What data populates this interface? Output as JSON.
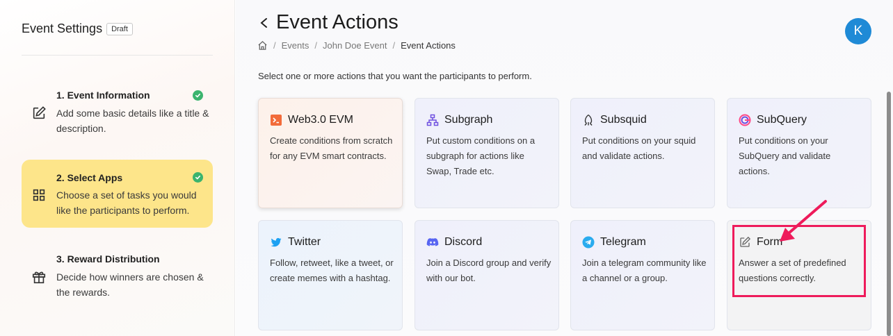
{
  "sidebar": {
    "title": "Event Settings",
    "badge": "Draft",
    "steps": [
      {
        "title": "1. Event Information",
        "desc": "Add some basic details like a title & description.",
        "icon": "edit-icon",
        "completed": true,
        "active": false
      },
      {
        "title": "2. Select Apps",
        "desc": "Choose a set of tasks you would like the participants to perform.",
        "icon": "grid-icon",
        "completed": true,
        "active": true
      },
      {
        "title": "3. Reward Distribution",
        "desc": "Decide how winners are chosen & the rewards.",
        "icon": "gift-icon",
        "completed": false,
        "active": false
      }
    ]
  },
  "header": {
    "title": "Event Actions",
    "breadcrumb": [
      "Events",
      "John Doe Event",
      "Event Actions"
    ],
    "avatar_letter": "K"
  },
  "instruction": "Select one or more actions that you want the participants to perform.",
  "cards": [
    {
      "title": "Web3.0 EVM",
      "desc": "Create conditions from scratch for any EVM smart contracts.",
      "icon": "terminal-icon",
      "color": "#f26b3a"
    },
    {
      "title": "Subgraph",
      "desc": "Put custom conditions on a subgraph for actions like Swap, Trade etc.",
      "icon": "sitemap-icon",
      "color": "#6f4fe0"
    },
    {
      "title": "Subsquid",
      "desc": "Put conditions on your squid and validate actions.",
      "icon": "squid-icon",
      "color": "#333333"
    },
    {
      "title": "SubQuery",
      "desc": "Put conditions on your SubQuery and validate actions.",
      "icon": "subquery-icon",
      "color": "#ff4785"
    },
    {
      "title": "Twitter",
      "desc": "Follow, retweet, like a tweet, or create memes with a hashtag.",
      "icon": "twitter-icon",
      "color": "#1da1f2"
    },
    {
      "title": "Discord",
      "desc": "Join a Discord group and verify with our bot.",
      "icon": "discord-icon",
      "color": "#5865f2"
    },
    {
      "title": "Telegram",
      "desc": "Join a telegram community like a channel or a group.",
      "icon": "telegram-icon",
      "color": "#2aabee"
    },
    {
      "title": "Form",
      "desc": "Answer a set of predefined questions correctly.",
      "icon": "form-icon",
      "color": "#666666"
    }
  ],
  "annotation": {
    "color": "#ee1b5b",
    "target": "Form"
  }
}
